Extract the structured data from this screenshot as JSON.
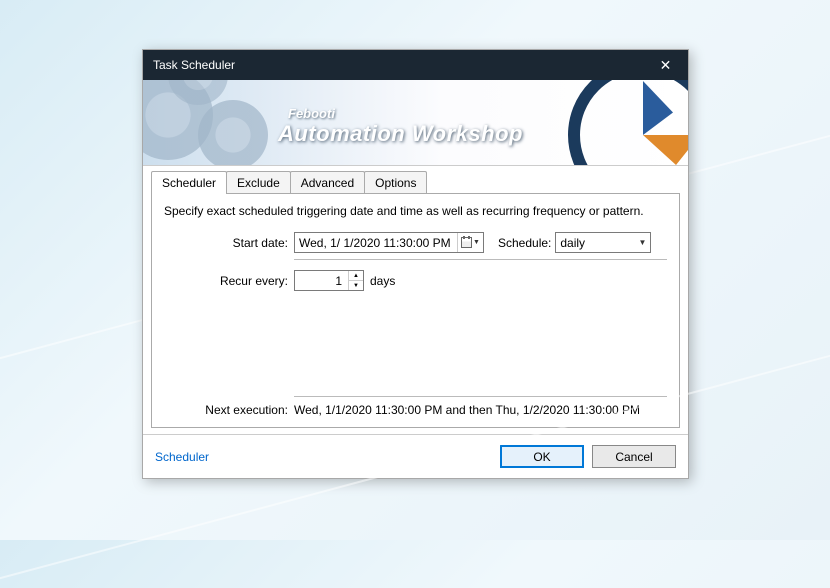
{
  "titlebar": {
    "title": "Task Scheduler"
  },
  "banner": {
    "small": "Febooti",
    "big": "Automation Workshop"
  },
  "tabs": [
    {
      "label": "Scheduler",
      "active": true
    },
    {
      "label": "Exclude",
      "active": false
    },
    {
      "label": "Advanced",
      "active": false
    },
    {
      "label": "Options",
      "active": false
    }
  ],
  "panel": {
    "description": "Specify exact scheduled triggering date and time as well as recurring frequency or pattern.",
    "start_label": "Start date:",
    "start_value": "Wed,   1/ 1/2020 11:30:00 PM",
    "schedule_label": "Schedule:",
    "schedule_value": "daily",
    "recur_label": "Recur every:",
    "recur_value": "1",
    "recur_unit": "days",
    "next_label": "Next execution:",
    "next_value": "Wed, 1/1/2020 11:30:00 PM and then Thu, 1/2/2020 11:30:00 PM"
  },
  "footer": {
    "link": "Scheduler",
    "ok": "OK",
    "cancel": "Cancel"
  }
}
